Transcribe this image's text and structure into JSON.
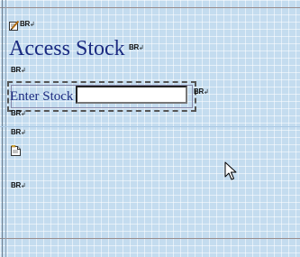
{
  "page": {
    "title": "Access Stock",
    "line_break_marker": "BR",
    "return_marker": "↲"
  },
  "form": {
    "stock_label": "Enter Stock",
    "stock_input_value": "",
    "stock_input_placeholder": ""
  },
  "icons": {
    "edit": "pencil-edit-icon",
    "document": "document-icon",
    "cursor": "mouse-pointer-icon"
  },
  "colors": {
    "background": "#c4dcef",
    "title_text": "#1a2a80"
  }
}
